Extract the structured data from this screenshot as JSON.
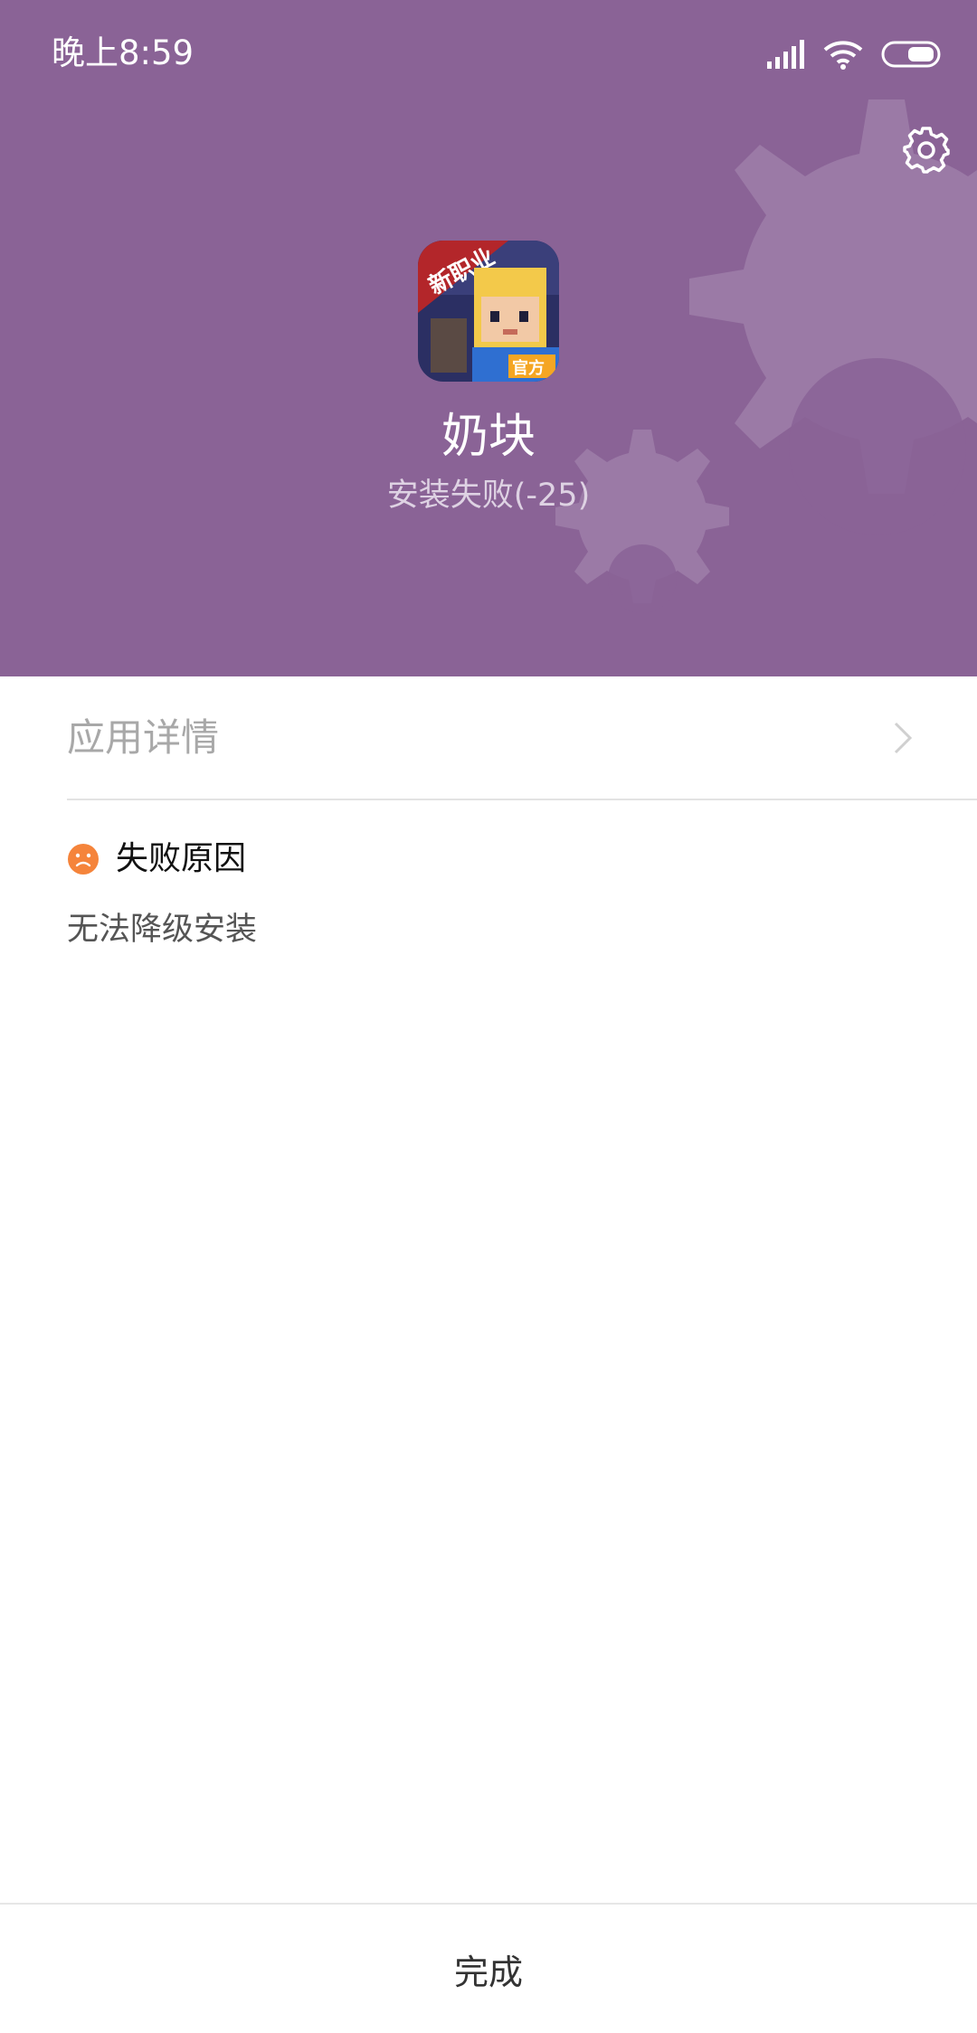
{
  "status_bar": {
    "time": "晚上8:59",
    "signal_icon": "signal-icon",
    "wifi_icon": "wifi-icon",
    "battery_icon": "battery-icon"
  },
  "header": {
    "background_color": "#8a6396",
    "settings_icon": "gear-icon",
    "app_icon": "app-icon",
    "app_name": "奶块",
    "install_status": "安装失败(-25)"
  },
  "details": {
    "label": "应用详情",
    "chevron_icon": "chevron-right-icon"
  },
  "failure": {
    "icon": "sad-face-icon",
    "icon_color": "#f5843b",
    "title": "失败原因",
    "reason": "无法降级安装"
  },
  "footer": {
    "done_label": "完成"
  }
}
